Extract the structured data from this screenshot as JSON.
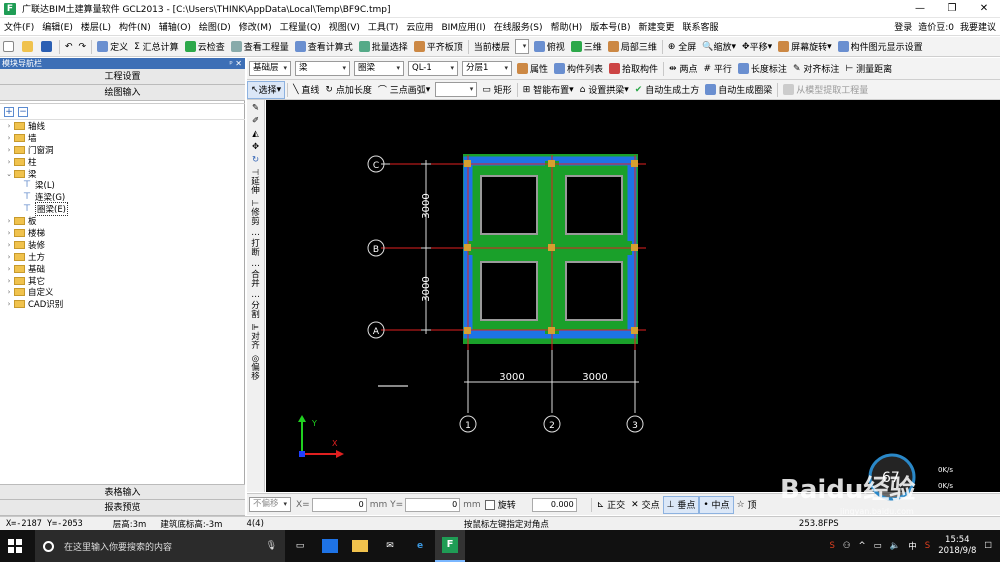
{
  "titlebar": {
    "title": "广联达BIM土建算量软件 GCL2013 - [C:\\Users\\THINK\\AppData\\Local\\Temp\\BF9C.tmp]",
    "minimize": "—",
    "restore": "❐",
    "close": "✕"
  },
  "menubar": {
    "items": [
      "文件(F)",
      "编辑(E)",
      "楼层(L)",
      "构件(N)",
      "辅轴(O)",
      "绘图(D)",
      "修改(M)",
      "工程量(Q)",
      "视图(V)",
      "工具(T)",
      "云应用",
      "BIM应用(I)",
      "在线服务(S)",
      "帮助(H)",
      "版本号(B)",
      "新建变更",
      "联系客服"
    ],
    "login": "登录",
    "cost": "造价豆:0",
    "suggest": "我要建议"
  },
  "toolbar1": {
    "define": "定义",
    "sum": "汇总计算",
    "cloud_check": "云检查",
    "view_qty": "查看工程量",
    "view_formula": "查看计算式",
    "batch_select": "批量选择",
    "align_slab": "平齐板顶",
    "current_floor": "当前楼层",
    "plan_view": "俯视",
    "three_d": "三维",
    "local_3d": "局部三维",
    "fullscreen": "全屏",
    "zoom": "缩放",
    "pan": "平移",
    "rotate": "屏幕旋转",
    "display_settings": "构件图元显示设置"
  },
  "nav": {
    "header": "模块导航栏",
    "pin": "ᵖ ✕",
    "project_settings": "工程设置",
    "drawing_input": "绘图输入",
    "tree": [
      {
        "label": "轴线",
        "level": 0,
        "expanded": false
      },
      {
        "label": "墙",
        "level": 0,
        "expanded": false
      },
      {
        "label": "门窗洞",
        "level": 0,
        "expanded": false
      },
      {
        "label": "柱",
        "level": 0,
        "expanded": false
      },
      {
        "label": "梁",
        "level": 0,
        "expanded": true
      },
      {
        "label": "梁(L)",
        "level": 1
      },
      {
        "label": "连梁(G)",
        "level": 1
      },
      {
        "label": "圈梁(E)",
        "level": 1,
        "selected": true
      },
      {
        "label": "板",
        "level": 0,
        "expanded": false
      },
      {
        "label": "楼梯",
        "level": 0,
        "expanded": false
      },
      {
        "label": "装修",
        "level": 0,
        "expanded": false
      },
      {
        "label": "土方",
        "level": 0,
        "expanded": false
      },
      {
        "label": "基础",
        "level": 0,
        "expanded": false
      },
      {
        "label": "其它",
        "level": 0,
        "expanded": false
      },
      {
        "label": "自定义",
        "level": 0,
        "expanded": false
      },
      {
        "label": "CAD识别",
        "level": 0,
        "expanded": false
      }
    ],
    "table_input": "表格输入",
    "report_preview": "报表预览"
  },
  "toolbar2": {
    "floor": "基础层",
    "category": "梁",
    "type": "圈梁",
    "component": "QL-1",
    "layer": "分层1",
    "properties": "属性",
    "component_list": "构件列表",
    "pick_component": "拾取构件",
    "two_point": "两点",
    "parallel": "平行",
    "length_dim": "长度标注",
    "align_dim": "对齐标注",
    "measure": "测量距离"
  },
  "toolbar3": {
    "select": "选择",
    "line": "直线",
    "point_length": "点加长度",
    "three_point_arc": "三点画弧",
    "rect": "矩形",
    "smart_layout": "智能布置",
    "set_arch": "设置拱梁",
    "auto_earth": "自动生成土方",
    "auto_ringbeam": "自动生成圈梁",
    "extract_model": "从模型提取工程量"
  },
  "vtools": [
    "延伸",
    "修剪",
    "打断",
    "合并",
    "分割",
    "对齐",
    "偏移"
  ],
  "drawing": {
    "axis_labels_v": [
      "C",
      "B",
      "A"
    ],
    "axis_labels_h": [
      "1",
      "2",
      "3"
    ],
    "dims_v": [
      "3000",
      "3000"
    ],
    "dims_h": [
      "3000",
      "3000"
    ],
    "ucs_x": "X",
    "ucs_y": "Y"
  },
  "bottombar": {
    "no_offset": "不偏移",
    "x_label": "X=",
    "x_val": "0",
    "y_label": "mm Y=",
    "y_val": "0",
    "mm": "mm",
    "rotate": "旋转",
    "rotate_val": "0.000",
    "ortho": "正交",
    "intersect": "交点",
    "perp": "垂点",
    "mid": "中点",
    "top": "顶"
  },
  "statusbar": {
    "coords": "X=-2187 Y=-2053",
    "floor_height": "层高:3m",
    "base_elev": "建筑底标高:-3m",
    "count": "4(4)",
    "hint": "按鼠标左键指定对角点",
    "fps": "253.8FPS"
  },
  "taskbar": {
    "search_placeholder": "在这里输入你要搜索的内容",
    "time": "15:54",
    "date": "2018/9/8",
    "ime": "中"
  },
  "watermark": {
    "netspeed": "67",
    "up": "0K/s",
    "down": "0K/s",
    "brand": "Baidu经验",
    "url": "jingyan.baidu.com"
  }
}
